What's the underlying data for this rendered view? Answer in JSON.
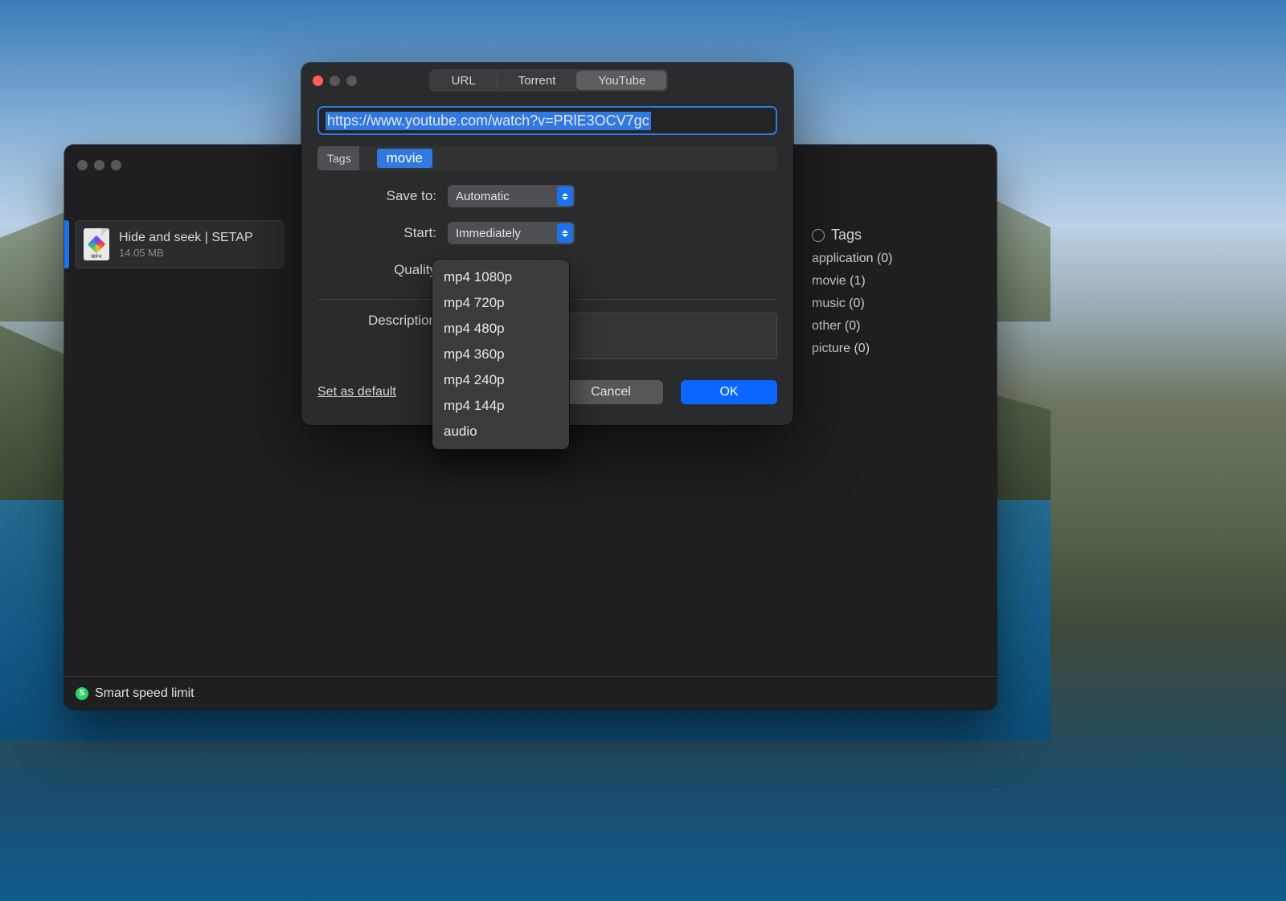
{
  "main": {
    "download": {
      "title": "Hide and seek | SETAP",
      "size": "14.05 MB",
      "filetype_label": "MP4"
    },
    "tags_panel": {
      "header": "Tags",
      "items": [
        "application (0)",
        "movie (1)",
        "music (0)",
        "other (0)",
        "picture (0)"
      ]
    },
    "status": {
      "badge": "S",
      "text": "Smart speed limit"
    }
  },
  "dialog": {
    "tabs": {
      "url": "URL",
      "torrent": "Torrent",
      "youtube": "YouTube",
      "active": "YouTube"
    },
    "url": "https://www.youtube.com/watch?v=PRlE3OCV7gc",
    "tags_label": "Tags",
    "tag_value": "movie",
    "save_to": {
      "label": "Save to:",
      "value": "Automatic"
    },
    "start": {
      "label": "Start:",
      "value": "Immediately"
    },
    "quality": {
      "label": "Quality",
      "options": [
        "mp4 1080p",
        "mp4 720p",
        "mp4 480p",
        "mp4 360p",
        "mp4 240p",
        "mp4 144p",
        "audio"
      ]
    },
    "description_label": "Description",
    "set_default": "Set as default",
    "cancel": "Cancel",
    "ok": "OK"
  }
}
